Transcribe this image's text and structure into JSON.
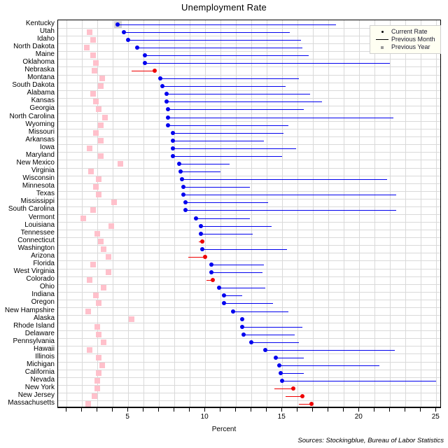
{
  "chart_data": {
    "type": "scatter",
    "title": "Unemployment Rate",
    "xlabel": "Percent",
    "ylabel": "",
    "xlim": [
      0.45,
      25.35
    ],
    "xticks": [
      5,
      10,
      15,
      20,
      25
    ],
    "xticklabels": [
      "5",
      "10",
      "15",
      "20",
      "25"
    ],
    "grid": true,
    "legend_position": "top-right",
    "series": [
      {
        "name": "Current Rate",
        "marker": "dot",
        "color": "#0000ee"
      },
      {
        "name": "Previous Month",
        "marker": "line",
        "color": "#0000ee"
      },
      {
        "name": "Previous Year",
        "marker": "square",
        "color": "#ffc0cb"
      }
    ],
    "categories": [
      "Kentucky",
      "Utah",
      "Idaho",
      "North Dakota",
      "Maine",
      "Oklahoma",
      "Nebraska",
      "Montana",
      "South Dakota",
      "Alabama",
      "Kansas",
      "Georgia",
      "North Carolina",
      "Wyoming",
      "Missouri",
      "Arkansas",
      "Iowa",
      "Maryland",
      "New Mexico",
      "Virginia",
      "Wisconsin",
      "Minnesota",
      "Texas",
      "Mississippi",
      "South Carolina",
      "Vermont",
      "Louisiana",
      "Tennessee",
      "Connecticut",
      "Washington",
      "Arizona",
      "Florida",
      "West Virginia",
      "Colorado",
      "Ohio",
      "Indiana",
      "Oregon",
      "New Hampshire",
      "Alaska",
      "Rhode Island",
      "Delaware",
      "Pennsylvania",
      "Hawaii",
      "Illinois",
      "Michigan",
      "California",
      "Nevada",
      "New York",
      "New Jersey",
      "Massachusetts"
    ],
    "rows": [
      {
        "state": "Kentucky",
        "current": 4.3,
        "previous_month": 18.5,
        "previous_year": null,
        "increase": false,
        "highlight": true
      },
      {
        "state": "Utah",
        "current": 4.7,
        "previous_month": 15.5,
        "previous_year": 2.5,
        "increase": false,
        "highlight": false
      },
      {
        "state": "Idaho",
        "current": 5.0,
        "previous_month": 16.2,
        "previous_year": 2.7,
        "increase": false,
        "highlight": false
      },
      {
        "state": "North Dakota",
        "current": 5.6,
        "previous_month": 16.3,
        "previous_year": 2.3,
        "increase": false,
        "highlight": false
      },
      {
        "state": "Maine",
        "current": 6.1,
        "previous_month": 16.7,
        "previous_year": 2.7,
        "increase": false,
        "highlight": false
      },
      {
        "state": "Oklahoma",
        "current": 6.1,
        "previous_month": 22.0,
        "previous_year": 2.9,
        "increase": false,
        "highlight": false
      },
      {
        "state": "Nebraska",
        "current": 6.7,
        "previous_month": 5.2,
        "previous_year": 2.8,
        "increase": true,
        "highlight": false
      },
      {
        "state": "Montana",
        "current": 7.1,
        "previous_month": 16.1,
        "previous_year": 3.3,
        "increase": false,
        "highlight": false
      },
      {
        "state": "South Dakota",
        "current": 7.2,
        "previous_month": 15.2,
        "previous_year": 3.2,
        "increase": false,
        "highlight": false
      },
      {
        "state": "Alabama",
        "current": 7.5,
        "previous_month": 16.8,
        "previous_year": 2.7,
        "increase": false,
        "highlight": false
      },
      {
        "state": "Kansas",
        "current": 7.5,
        "previous_month": 17.6,
        "previous_year": 2.9,
        "increase": false,
        "highlight": false
      },
      {
        "state": "Georgia",
        "current": 7.6,
        "previous_month": 16.4,
        "previous_year": 3.1,
        "increase": false,
        "highlight": false
      },
      {
        "state": "North Carolina",
        "current": 7.6,
        "previous_month": 22.2,
        "previous_year": 3.5,
        "increase": false,
        "highlight": false
      },
      {
        "state": "Wyoming",
        "current": 7.6,
        "previous_month": 15.4,
        "previous_year": 3.2,
        "increase": false,
        "highlight": false
      },
      {
        "state": "Missouri",
        "current": 7.9,
        "previous_month": 15.1,
        "previous_year": 2.9,
        "increase": false,
        "highlight": false
      },
      {
        "state": "Arkansas",
        "current": 7.9,
        "previous_month": 13.8,
        "previous_year": 3.2,
        "increase": false,
        "highlight": false
      },
      {
        "state": "Iowa",
        "current": 7.9,
        "previous_month": 15.9,
        "previous_year": 2.5,
        "increase": false,
        "highlight": false
      },
      {
        "state": "Maryland",
        "current": 7.9,
        "previous_month": 15.0,
        "previous_year": 3.2,
        "increase": false,
        "highlight": false
      },
      {
        "state": "New Mexico",
        "current": 8.3,
        "previous_month": 11.6,
        "previous_year": 4.5,
        "increase": false,
        "highlight": false
      },
      {
        "state": "Virginia",
        "current": 8.4,
        "previous_month": 11.0,
        "previous_year": 2.6,
        "increase": false,
        "highlight": false
      },
      {
        "state": "Wisconsin",
        "current": 8.5,
        "previous_month": 21.8,
        "previous_year": 3.1,
        "increase": false,
        "highlight": false
      },
      {
        "state": "Minnesota",
        "current": 8.6,
        "previous_month": 12.9,
        "previous_year": 2.9,
        "increase": false,
        "highlight": false
      },
      {
        "state": "Texas",
        "current": 8.6,
        "previous_month": 22.4,
        "previous_year": 3.1,
        "increase": false,
        "highlight": false
      },
      {
        "state": "Mississippi",
        "current": 8.7,
        "previous_month": 14.1,
        "previous_year": 4.1,
        "increase": false,
        "highlight": false
      },
      {
        "state": "South Carolina",
        "current": 8.7,
        "previous_month": 22.4,
        "previous_year": 2.7,
        "increase": false,
        "highlight": false
      },
      {
        "state": "Vermont",
        "current": 9.4,
        "previous_month": 12.9,
        "previous_year": 2.1,
        "increase": false,
        "highlight": false
      },
      {
        "state": "Louisiana",
        "current": 9.7,
        "previous_month": 14.3,
        "previous_year": 3.9,
        "increase": false,
        "highlight": false
      },
      {
        "state": "Tennessee",
        "current": 9.7,
        "previous_month": 13.1,
        "previous_year": 3.0,
        "increase": false,
        "highlight": false
      },
      {
        "state": "Connecticut",
        "current": 9.8,
        "previous_month": 9.6,
        "previous_year": 3.2,
        "increase": true,
        "highlight": false
      },
      {
        "state": "Washington",
        "current": 9.8,
        "previous_month": 15.3,
        "previous_year": 3.4,
        "increase": false,
        "highlight": false
      },
      {
        "state": "Arizona",
        "current": 10.0,
        "previous_month": 8.9,
        "previous_year": 3.7,
        "increase": true,
        "highlight": false
      },
      {
        "state": "Florida",
        "current": 10.4,
        "previous_month": 13.8,
        "previous_year": 2.7,
        "increase": false,
        "highlight": false
      },
      {
        "state": "West Virginia",
        "current": 10.4,
        "previous_month": 13.7,
        "previous_year": 3.7,
        "increase": false,
        "highlight": false
      },
      {
        "state": "Colorado",
        "current": 10.5,
        "previous_month": 10.1,
        "previous_year": 2.5,
        "increase": true,
        "highlight": false
      },
      {
        "state": "Ohio",
        "current": 10.9,
        "previous_month": 13.9,
        "previous_year": 3.4,
        "increase": false,
        "highlight": false
      },
      {
        "state": "Indiana",
        "current": 11.2,
        "previous_month": 12.4,
        "previous_year": 2.9,
        "increase": false,
        "highlight": false
      },
      {
        "state": "Oregon",
        "current": 11.2,
        "previous_month": 14.4,
        "previous_year": 3.1,
        "increase": false,
        "highlight": false
      },
      {
        "state": "New Hampshire",
        "current": 11.8,
        "previous_month": 15.4,
        "previous_year": 2.4,
        "increase": false,
        "highlight": false
      },
      {
        "state": "Alaska",
        "current": 12.4,
        "previous_month": 12.4,
        "previous_year": 5.2,
        "increase": false,
        "highlight": false
      },
      {
        "state": "Rhode Island",
        "current": 12.4,
        "previous_month": 16.3,
        "previous_year": 3.0,
        "increase": false,
        "highlight": false
      },
      {
        "state": "Delaware",
        "current": 12.5,
        "previous_month": 15.8,
        "previous_year": 3.1,
        "increase": false,
        "highlight": false
      },
      {
        "state": "Pennsylvania",
        "current": 13.0,
        "previous_month": 16.1,
        "previous_year": 3.4,
        "increase": false,
        "highlight": false
      },
      {
        "state": "Hawaii",
        "current": 13.9,
        "previous_month": 22.3,
        "previous_year": 2.5,
        "increase": false,
        "highlight": false
      },
      {
        "state": "Illinois",
        "current": 14.6,
        "previous_month": 16.4,
        "previous_year": 3.1,
        "increase": false,
        "highlight": false
      },
      {
        "state": "Michigan",
        "current": 14.8,
        "previous_month": 21.3,
        "previous_year": 3.3,
        "increase": false,
        "highlight": false
      },
      {
        "state": "California",
        "current": 14.9,
        "previous_month": 16.4,
        "previous_year": 3.1,
        "increase": false,
        "highlight": false
      },
      {
        "state": "Nevada",
        "current": 15.0,
        "previous_month": 25.0,
        "previous_year": 3.0,
        "increase": false,
        "highlight": false
      },
      {
        "state": "New York",
        "current": 15.7,
        "previous_month": 14.5,
        "previous_year": 3.0,
        "increase": true,
        "highlight": false
      },
      {
        "state": "New Jersey",
        "current": 16.3,
        "previous_month": 15.2,
        "previous_year": 2.8,
        "increase": true,
        "highlight": false
      },
      {
        "state": "Massachusetts",
        "current": 16.9,
        "previous_month": 16.1,
        "previous_year": 2.4,
        "increase": true,
        "highlight": false
      }
    ]
  },
  "legend": {
    "items": [
      {
        "label": "Current Rate",
        "key": "dot"
      },
      {
        "label": "Previous Month",
        "key": "line"
      },
      {
        "label": "Previous Year",
        "key": "square"
      }
    ]
  },
  "footer": {
    "sources": "Sources: Stockingblue, Bureau of Labor Statistics"
  },
  "colors": {
    "decrease": "#0000ee",
    "increase": "#ee0000",
    "previous_year": "#ffc0cb",
    "grid": "#d9d9d9",
    "axis": "#000000"
  }
}
